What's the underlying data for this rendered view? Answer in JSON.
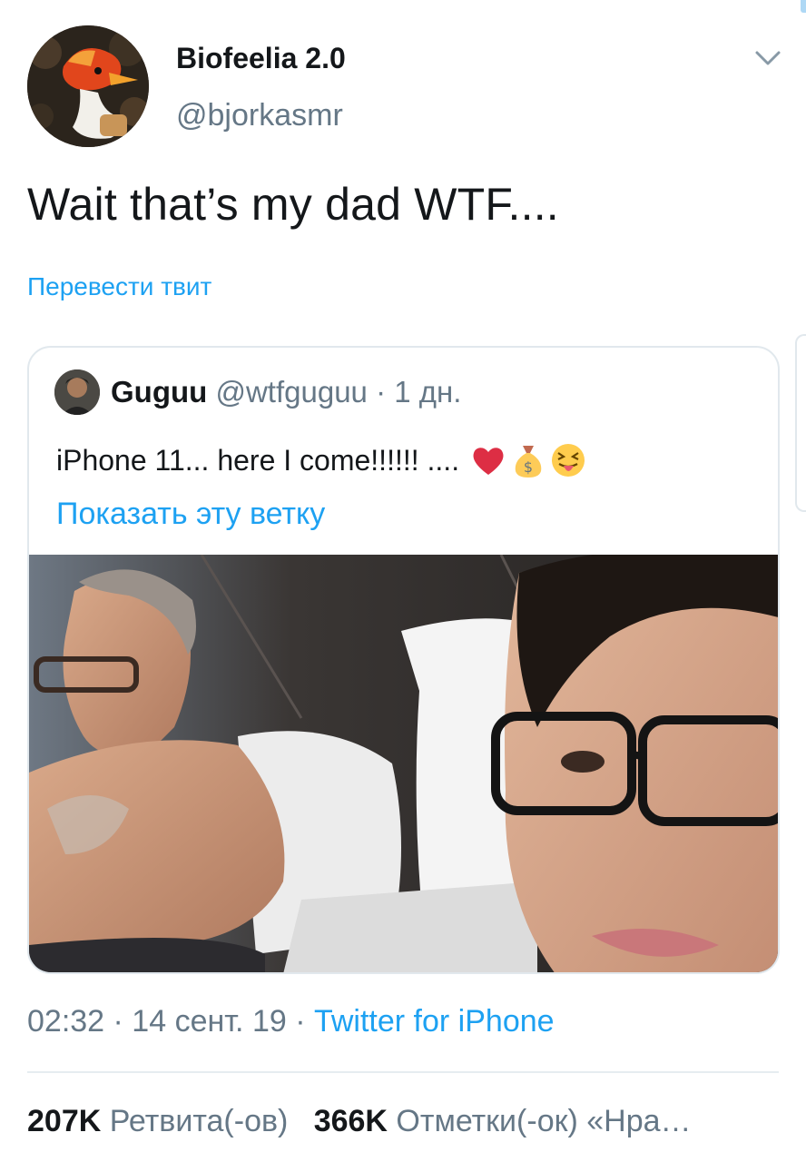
{
  "tweet": {
    "author_name": "Biofeelia 2.0",
    "author_handle": "@bjorkasmr",
    "text": "Wait that’s my dad WTF....",
    "translate_label": "Перевести твит",
    "menu_icon": "chevron-down-icon",
    "timestamp": "02:32 · 14 сент. 19 · ",
    "source": "Twitter for iPhone"
  },
  "quote": {
    "name": "Guguu",
    "meta": " @wtfguguu · 1 дн.",
    "text": "iPhone 11... here I come!!!!!!  ....",
    "emojis": [
      "red-heart-icon",
      "money-bag-icon",
      "squinting-tongue-face-icon"
    ],
    "show_thread_label": "Показать эту ветку"
  },
  "stats": {
    "retweets_count": "207K",
    "retweets_label": " Ретвита(-ов)",
    "likes_count": "366K",
    "likes_label": " Отметки(-ок) «Нра…"
  },
  "colors": {
    "link": "#1da1f2",
    "secondary_text": "#657786",
    "primary_text": "#14171a",
    "border": "#e1e8ed"
  }
}
